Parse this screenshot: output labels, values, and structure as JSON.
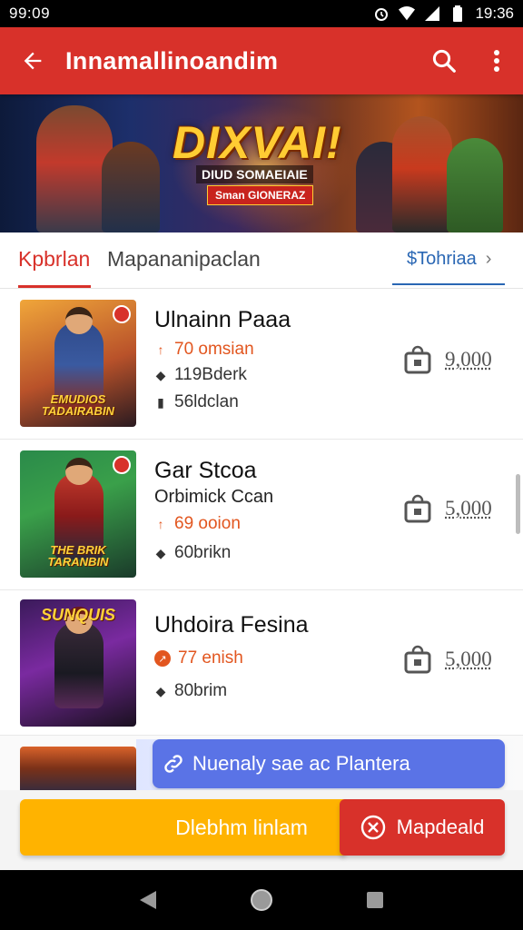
{
  "status_bar": {
    "time": "99:09",
    "clock_right": "19:36",
    "icons": [
      "alarm-icon",
      "wifi-icon",
      "signal-icon",
      "battery-icon"
    ]
  },
  "app_bar": {
    "title": "Innamallinoandim",
    "back_icon": "arrow-left-icon",
    "search_icon": "search-icon",
    "menu_icon": "more-vert-icon",
    "color": "#d8312a"
  },
  "banner": {
    "title": "DIXVAI!",
    "tag": "DIUD SOMAEIAIE",
    "badge": "Sman GIONERAZ"
  },
  "tabs": {
    "active": "Kpbrlan",
    "second": "Mapananipaclan",
    "link": "$Tohriaa",
    "link_color": "#2a67b4"
  },
  "items": [
    {
      "title": "Ulnainn Paaa",
      "hot": "70 omsian",
      "meta1": "119Bderk",
      "meta2": "56ldclan",
      "price": "9,000",
      "caption": "EMUDIOS TADAIRABIN"
    },
    {
      "title": "Gar Stcoa",
      "subtitle": "Orbimick Ccan",
      "hot": "69 ooion",
      "meta1": "60brikn",
      "price": "5,000",
      "caption": "THE BRIK TARANBIN"
    },
    {
      "title": "Uhdoira Fesina",
      "hot": "77 enish",
      "meta1": "80brim",
      "price": "5,000",
      "caption": "SUNQUIS"
    }
  ],
  "promo": {
    "label": "Nuenaly sae ac Plantera",
    "icon": "link-icon"
  },
  "actions": {
    "primary": "Dlebhm linlam",
    "secondary": "Mapdeald",
    "primary_color": "#ffb300",
    "secondary_color": "#d8312a"
  },
  "nav": [
    "back-triangle-icon",
    "home-circle-icon",
    "recents-square-icon"
  ]
}
